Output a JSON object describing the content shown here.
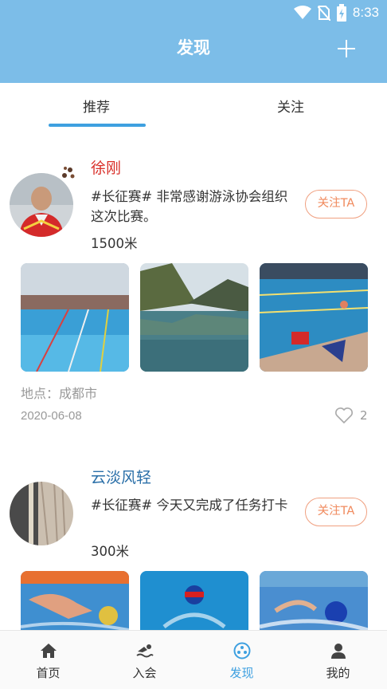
{
  "status": {
    "time": "8:33"
  },
  "header": {
    "title": "发现"
  },
  "tabs": [
    {
      "label": "推荐"
    },
    {
      "label": "关注"
    }
  ],
  "posts": [
    {
      "name": "徐刚",
      "name_color": "#d9302a",
      "text": "#长征赛# 非常感谢游泳协会组织这次比赛。",
      "distance": "1500米",
      "follow_label": "关注TA",
      "location": "地点：成都市",
      "date": "2020-06-08",
      "likes": "2"
    },
    {
      "name": "云淡风轻",
      "name_color": "#2a6fa8",
      "text": "#长征赛# 今天又完成了任务打卡",
      "distance": "300米",
      "follow_label": "关注TA"
    }
  ],
  "nav": [
    {
      "label": "首页",
      "icon": "home-icon"
    },
    {
      "label": "入会",
      "icon": "swim-icon"
    },
    {
      "label": "发现",
      "icon": "discover-icon"
    },
    {
      "label": "我的",
      "icon": "user-icon"
    }
  ],
  "colors": {
    "header": "#7cbde8",
    "accent": "#3ea0e0",
    "follow": "#f08a5d"
  }
}
